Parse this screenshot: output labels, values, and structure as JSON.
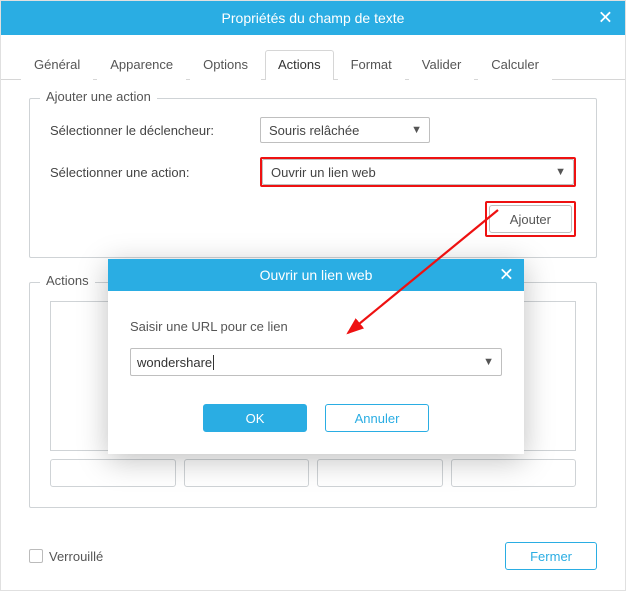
{
  "dialog": {
    "title": "Propriétés du champ de texte"
  },
  "tabs": {
    "general": "Général",
    "appearance": "Apparence",
    "options": "Options",
    "actions": "Actions",
    "format": "Format",
    "validate": "Valider",
    "calculate": "Calculer",
    "active": "actions"
  },
  "add_action_section": {
    "legend": "Ajouter une action",
    "trigger_label": "Sélectionner le déclencheur:",
    "trigger_value": "Souris relâchée",
    "action_label": "Sélectionner une action:",
    "action_value": "Ouvrir un lien web",
    "add_button": "Ajouter"
  },
  "actions_section": {
    "legend": "Actions"
  },
  "inner_modal": {
    "title": "Ouvrir un lien web",
    "prompt": "Saisir une URL pour ce lien",
    "url_value": "wondershare",
    "ok": "OK",
    "cancel": "Annuler"
  },
  "footer": {
    "locked_label": "Verrouillé",
    "close_button": "Fermer"
  },
  "annotation": {
    "color": "#e11"
  }
}
